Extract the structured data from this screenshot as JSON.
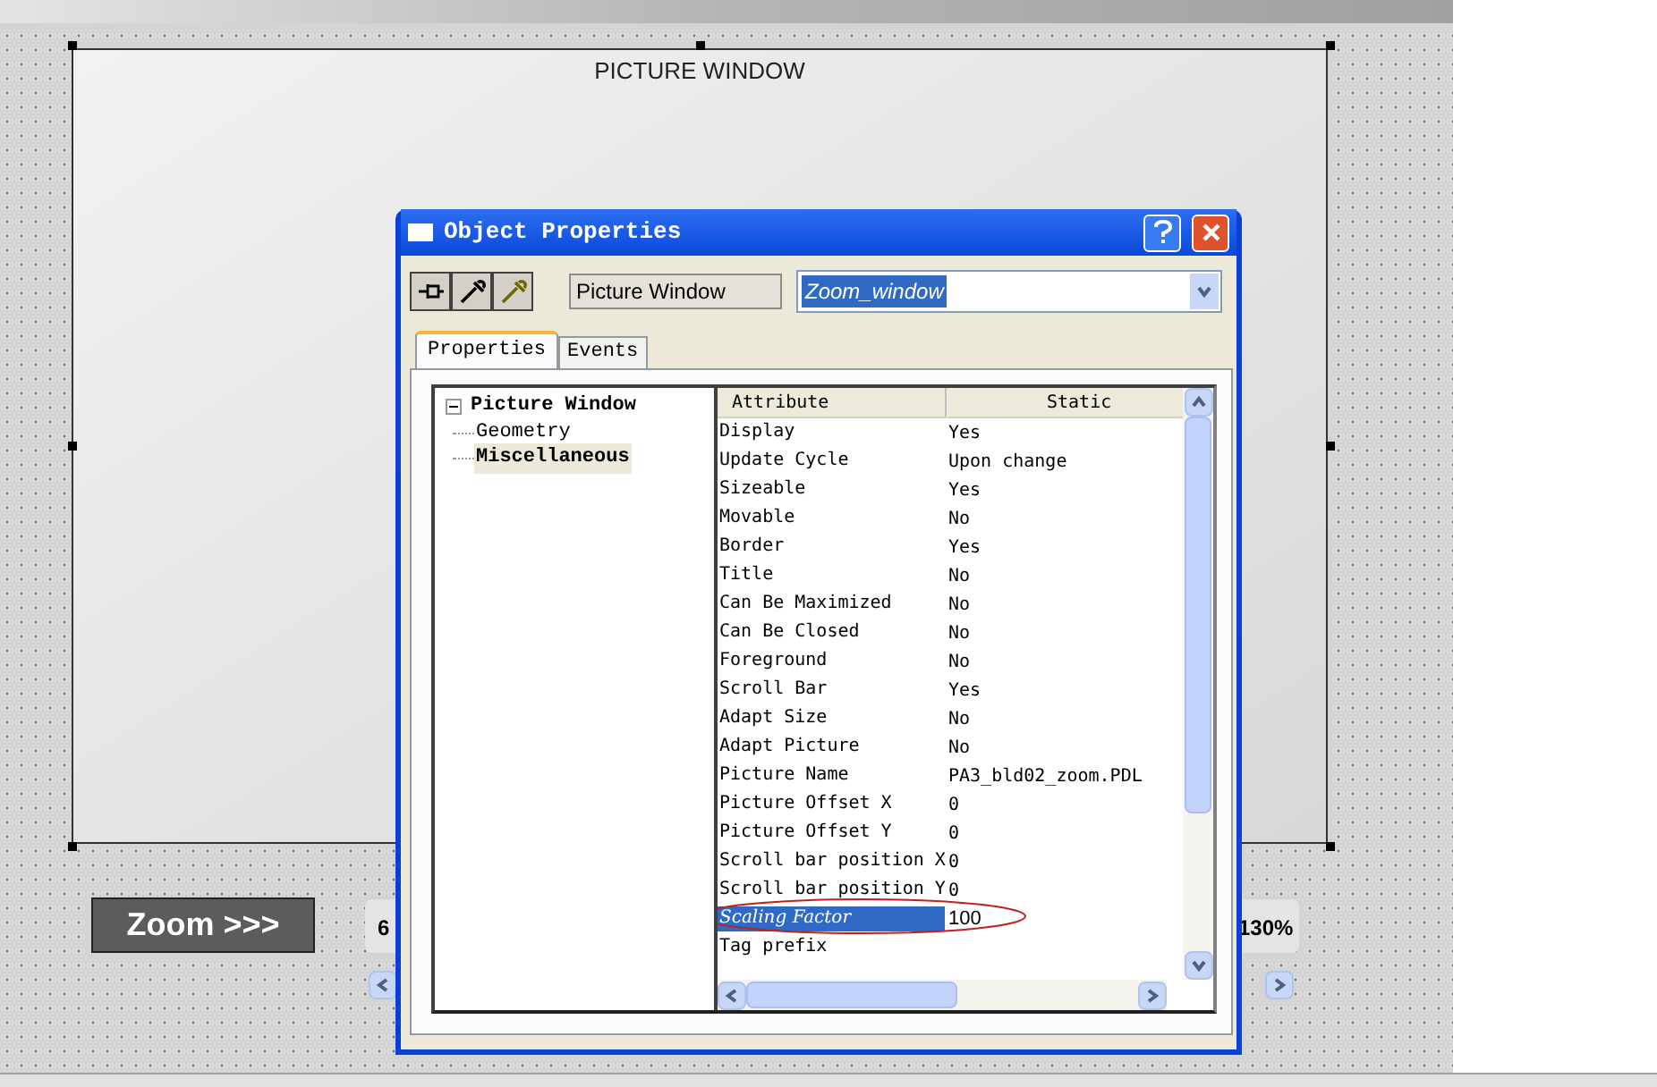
{
  "canvas": {
    "picture_window": {
      "label": "PICTURE WINDOW"
    },
    "zoom_button": "Zoom >>>",
    "zoom_min_label": "6",
    "zoom_max_label": "130%"
  },
  "dialog": {
    "title": "Object Properties",
    "object_type": "Picture Window",
    "object_name": {
      "value": "Zoom_window",
      "selected": true
    },
    "tabs": [
      {
        "label": "Properties",
        "selected": true
      },
      {
        "label": "Events",
        "selected": false
      }
    ],
    "tree": [
      {
        "label": "Picture Window",
        "expanded": true,
        "children": [
          {
            "label": "Geometry",
            "selected": false
          },
          {
            "label": "Miscellaneous",
            "selected": true
          }
        ]
      }
    ],
    "columns": [
      "Attribute",
      "Static"
    ],
    "rows": [
      {
        "attribute": "Display",
        "value": "Yes",
        "selected": false
      },
      {
        "attribute": "Update Cycle",
        "value": "Upon change",
        "selected": false
      },
      {
        "attribute": "Sizeable",
        "value": "Yes",
        "selected": false
      },
      {
        "attribute": "Movable",
        "value": "No",
        "selected": false
      },
      {
        "attribute": "Border",
        "value": "Yes",
        "selected": false
      },
      {
        "attribute": "Title",
        "value": "No",
        "selected": false
      },
      {
        "attribute": "Can Be Maximized",
        "value": "No",
        "selected": false
      },
      {
        "attribute": "Can Be Closed",
        "value": "No",
        "selected": false
      },
      {
        "attribute": "Foreground",
        "value": "No",
        "selected": false
      },
      {
        "attribute": "Scroll Bar",
        "value": "Yes",
        "selected": false
      },
      {
        "attribute": "Adapt Size",
        "value": "No",
        "selected": false
      },
      {
        "attribute": "Adapt Picture",
        "value": "No",
        "selected": false
      },
      {
        "attribute": "Picture Name",
        "value": "PA3_bld02_zoom.PDL",
        "selected": false
      },
      {
        "attribute": "Picture Offset X",
        "value": "0",
        "selected": false
      },
      {
        "attribute": "Picture Offset Y",
        "value": "0",
        "selected": false
      },
      {
        "attribute": "Scroll bar position X",
        "value": "0",
        "selected": false
      },
      {
        "attribute": "Scroll bar position Y",
        "value": "0",
        "selected": false
      },
      {
        "attribute": "Scaling Factor",
        "value": "100",
        "selected": true
      },
      {
        "attribute": "Tag prefix",
        "selected": false
      }
    ]
  }
}
